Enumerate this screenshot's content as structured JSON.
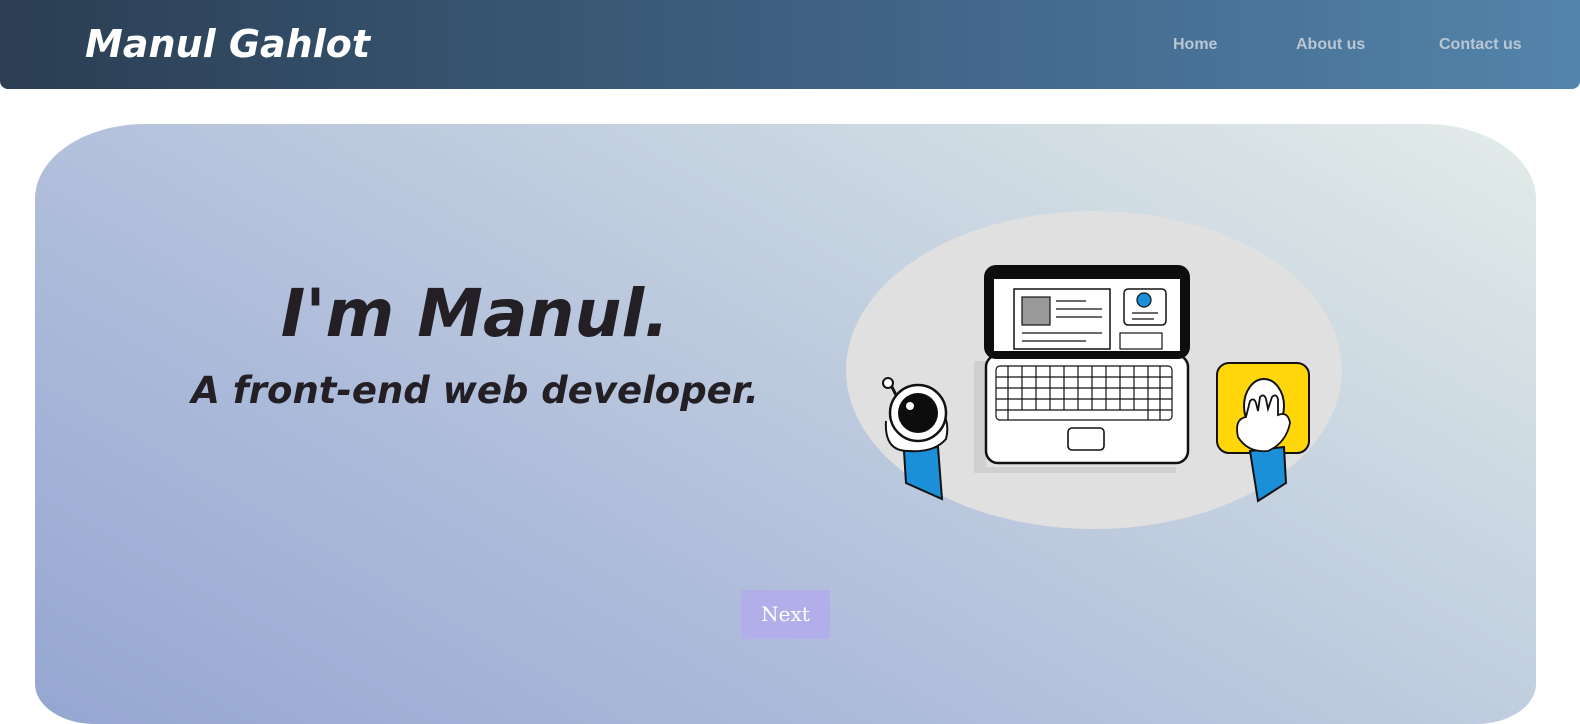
{
  "header": {
    "brand": "Manul Gahlot",
    "nav": [
      {
        "label": "Home"
      },
      {
        "label": "About us"
      },
      {
        "label": "Contact us"
      }
    ]
  },
  "hero": {
    "title": "I'm Manul.",
    "subtitle": "A front-end web developer.",
    "next_label": "Next"
  },
  "colors": {
    "header_start": "#2b3e52",
    "header_end": "#5384ab",
    "button_bg": "#b2aeea",
    "text_dark": "#231f25"
  },
  "icons": [
    "laptop-illustration",
    "coffee-cup-icon",
    "mouse-icon"
  ]
}
